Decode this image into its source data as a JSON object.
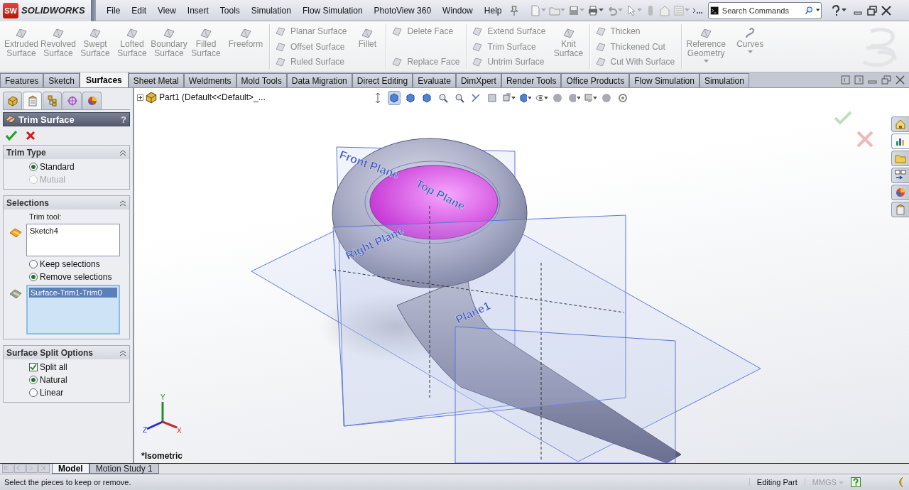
{
  "logo": {
    "badge": "SW",
    "name": "SOLIDWORKS"
  },
  "menu": [
    "File",
    "Edit",
    "View",
    "Insert",
    "Tools",
    "Simulation",
    "Flow Simulation",
    "PhotoView 360",
    "Window",
    "Help"
  ],
  "search": {
    "placeholder": "Search Commands"
  },
  "ribbon": [
    {
      "kind": "large",
      "label": "Extruded Surface"
    },
    {
      "kind": "large",
      "label": "Revolved Surface"
    },
    {
      "kind": "large",
      "label": "Swept Surface"
    },
    {
      "kind": "large",
      "label": "Lofted Surface"
    },
    {
      "kind": "large",
      "label": "Boundary Surface"
    },
    {
      "kind": "large",
      "label": "Filled Surface"
    },
    {
      "kind": "large",
      "label": "Freeform"
    },
    {
      "kind": "separator"
    },
    {
      "kind": "stack",
      "items": [
        "Planar Surface",
        "Offset Surface",
        "Ruled Surface"
      ]
    },
    {
      "kind": "large",
      "label": "Fillet"
    },
    {
      "kind": "separator"
    },
    {
      "kind": "stack",
      "items": [
        "Delete Face",
        "Replace Face"
      ]
    },
    {
      "kind": "separator"
    },
    {
      "kind": "stack",
      "items": [
        "Extend Surface",
        "Trim Surface",
        "Untrim Surface"
      ]
    },
    {
      "kind": "large",
      "label": "Knit Surface"
    },
    {
      "kind": "separator"
    },
    {
      "kind": "stack",
      "items": [
        "Thicken",
        "Thickened Cut",
        "Cut With Surface"
      ]
    },
    {
      "kind": "separator"
    },
    {
      "kind": "large",
      "label": "Reference Geometry",
      "menu": true
    },
    {
      "kind": "large",
      "label": "Curves",
      "menu": true
    }
  ],
  "tabs": [
    {
      "label": "Features",
      "selected": false
    },
    {
      "label": "Sketch",
      "selected": false
    },
    {
      "label": "Surfaces",
      "selected": true
    },
    {
      "label": "Sheet Metal",
      "selected": false
    },
    {
      "label": "Weldments",
      "selected": false
    },
    {
      "label": "Mold Tools",
      "selected": false
    },
    {
      "label": "Data Migration",
      "selected": false
    },
    {
      "label": "Direct Editing",
      "selected": false
    },
    {
      "label": "Evaluate",
      "selected": false
    },
    {
      "label": "DimXpert",
      "selected": false
    },
    {
      "label": "Render Tools",
      "selected": false
    },
    {
      "label": "Office Products",
      "selected": false
    },
    {
      "label": "Flow Simulation",
      "selected": false
    },
    {
      "label": "Simulation",
      "selected": false
    }
  ],
  "property_manager": {
    "title": "Trim Surface",
    "help": "?",
    "sections": [
      {
        "title": "Trim Type",
        "items": [
          {
            "kind": "radio",
            "label": "Standard",
            "selected": true,
            "disabled": false
          },
          {
            "kind": "radio",
            "label": "Mutual",
            "selected": false,
            "disabled": true
          }
        ]
      },
      {
        "title": "Selections",
        "items": [
          {
            "kind": "caption",
            "label": "Trim tool:"
          },
          {
            "kind": "list",
            "active": false,
            "entries": [
              {
                "label": "Sketch4",
                "selected": false
              }
            ]
          },
          {
            "kind": "radio",
            "label": "Keep selections",
            "selected": false,
            "disabled": false
          },
          {
            "kind": "radio",
            "label": "Remove selections",
            "selected": true,
            "disabled": false
          },
          {
            "kind": "list",
            "active": true,
            "entries": [
              {
                "label": "Surface-Trim1-Trim0",
                "selected": true
              }
            ]
          }
        ]
      },
      {
        "title": "Surface Split Options",
        "items": [
          {
            "kind": "checkbox",
            "label": "Split all",
            "checked": true
          },
          {
            "kind": "radio",
            "label": "Natural",
            "selected": true,
            "disabled": false
          },
          {
            "kind": "radio",
            "label": "Linear",
            "selected": false,
            "disabled": false
          }
        ]
      }
    ]
  },
  "feature_tree": {
    "label": "Part1  (Default<<Default>_...",
    "expanded": false
  },
  "viewport": {
    "view_name": "*Isometric",
    "plane_labels": [
      "Front Plane",
      "Top Plane",
      "Right Plane",
      "Plane1"
    ],
    "axes": [
      "Y",
      "Z",
      "X"
    ]
  },
  "bottom_tabs": [
    {
      "label": "Model",
      "selected": true
    },
    {
      "label": "Motion Study 1",
      "selected": false
    }
  ],
  "status_bar": {
    "message": "Select the pieces to keep or remove.",
    "mode": "Editing Part",
    "units": "MMGS"
  }
}
